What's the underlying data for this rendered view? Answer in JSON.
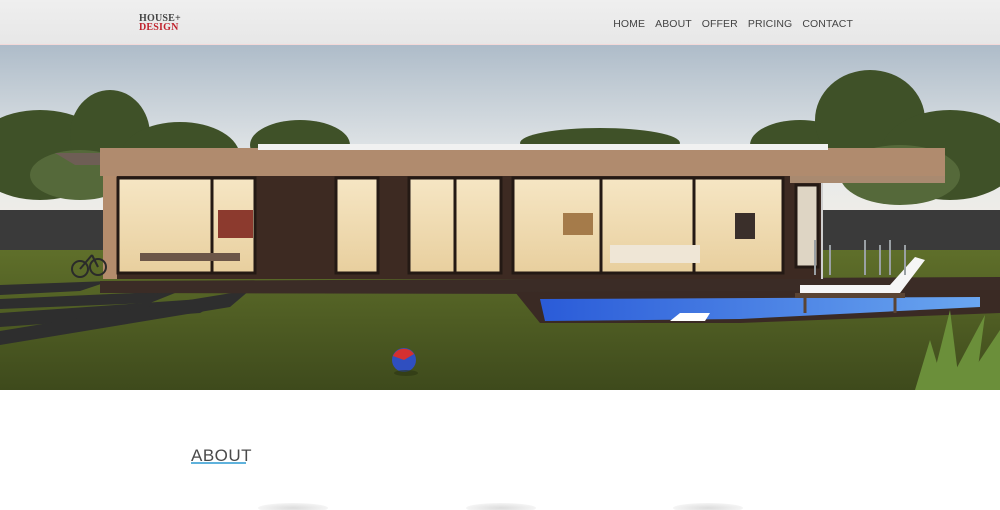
{
  "logo": {
    "line1": "HOUSE+",
    "line2": "DESIGN"
  },
  "nav": {
    "home": "HOME",
    "about": "ABOUT",
    "offer": "OFFER",
    "pricing": "PRICING",
    "contact": "CONTACT"
  },
  "section": {
    "title": "ABOUT"
  },
  "colors": {
    "accent": "#5fb2dc",
    "brand_red": "#c0222d",
    "header_bg": "#ececec"
  }
}
